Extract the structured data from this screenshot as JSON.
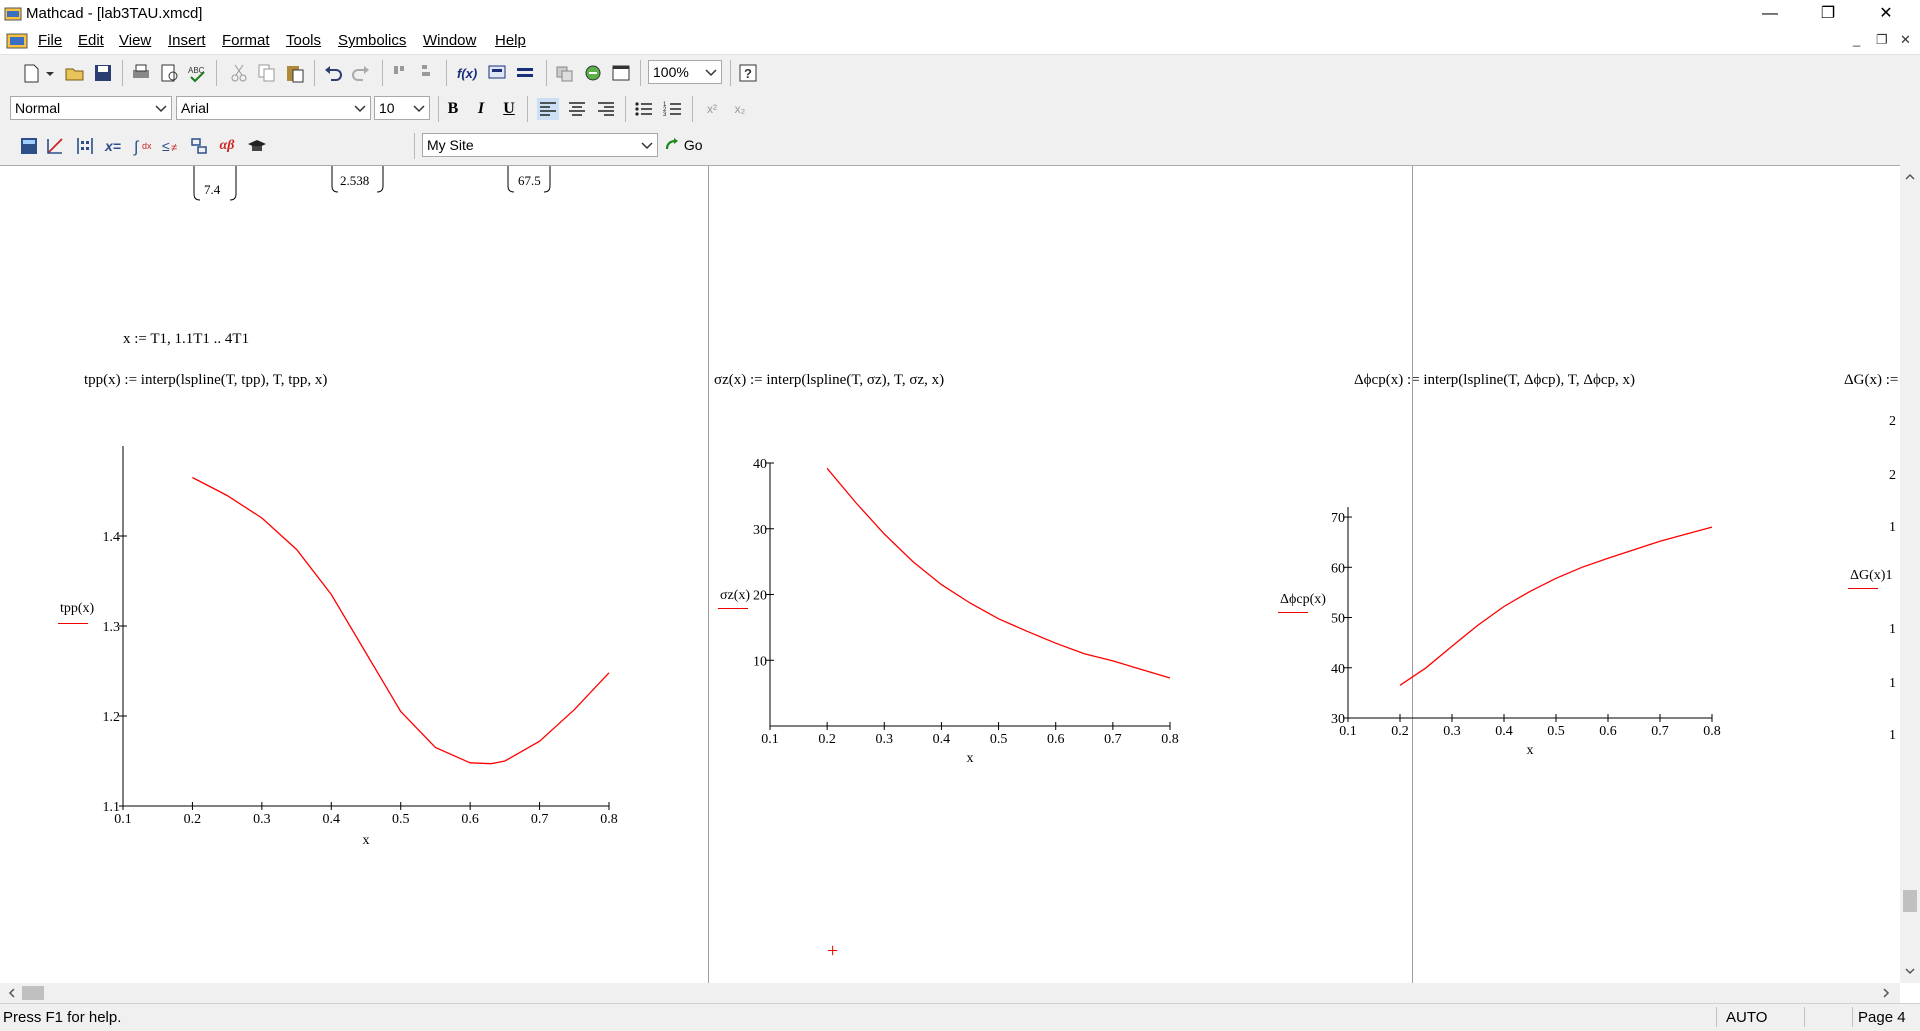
{
  "window": {
    "title": "Mathcad - [lab3TAU.xmcd]",
    "minimize": "—",
    "restore": "❐",
    "close": "✕"
  },
  "menu": {
    "items": [
      {
        "label": "File",
        "accel": "F"
      },
      {
        "label": "Edit",
        "accel": "E"
      },
      {
        "label": "View",
        "accel": "V"
      },
      {
        "label": "Insert",
        "accel": "I"
      },
      {
        "label": "Format",
        "accel": "o"
      },
      {
        "label": "Tools",
        "accel": "T"
      },
      {
        "label": "Symbolics",
        "accel": "S"
      },
      {
        "label": "Window",
        "accel": "W"
      },
      {
        "label": "Help",
        "accel": "H"
      }
    ],
    "mdi_min": "_",
    "mdi_restore": "❐",
    "mdi_close": "✕"
  },
  "toolbar": {
    "zoom": "100%"
  },
  "formatbar": {
    "style": "Normal",
    "font": "Arial",
    "size": "10",
    "bold": "B",
    "italic": "I",
    "underline": "U",
    "superscript": "x²",
    "subscript": "x₂"
  },
  "mathbar": {
    "site": "My Site",
    "go": "Go",
    "xeq": "x=",
    "greek": "αβ"
  },
  "doc": {
    "vec_top_1": "7.4",
    "vec_top_2": "2.538",
    "vec_top_3": "67.5",
    "range_def": "x := T1, 1.1T1 .. 4T1",
    "def_tpp": "tpp(x) := interp(lspline(T, tpp), T, tpp, x)",
    "def_sz": "σz(x) := interp(lspline(T, σz), T, σz, x)",
    "def_dfcp": "Δϕcp(x) := interp(lspline(T, Δϕcp), T, Δϕcp, x)",
    "def_dg": "ΔG(x) :=",
    "cross_marker": "+"
  },
  "chart_data": [
    {
      "type": "line",
      "ylabel": "tpp(x)",
      "xlabel": "x",
      "xlim": [
        0.1,
        0.8
      ],
      "ylim": [
        1.1,
        1.5
      ],
      "xticks": [
        "0.1",
        "0.2",
        "0.3",
        "0.4",
        "0.5",
        "0.6",
        "0.7",
        "0.8"
      ],
      "yticks": [
        "1.1",
        "1.2",
        "1.3",
        "1.4"
      ],
      "color": "#ff0000",
      "x": [
        0.2,
        0.25,
        0.3,
        0.35,
        0.4,
        0.45,
        0.5,
        0.55,
        0.6,
        0.63,
        0.65,
        0.7,
        0.75,
        0.8
      ],
      "y": [
        1.465,
        1.445,
        1.42,
        1.385,
        1.335,
        1.27,
        1.205,
        1.165,
        1.148,
        1.147,
        1.15,
        1.172,
        1.207,
        1.248
      ]
    },
    {
      "type": "line",
      "ylabel": "σz(x)",
      "xlabel": "x",
      "xlim": [
        0.1,
        0.8
      ],
      "ylim": [
        0,
        40
      ],
      "xticks": [
        "0.1",
        "0.2",
        "0.3",
        "0.4",
        "0.5",
        "0.6",
        "0.7",
        "0.8"
      ],
      "yticks": [
        "10",
        "20",
        "30",
        "40"
      ],
      "color": "#ff0000",
      "x": [
        0.2,
        0.25,
        0.3,
        0.35,
        0.4,
        0.45,
        0.5,
        0.55,
        0.6,
        0.65,
        0.7,
        0.75,
        0.8
      ],
      "y": [
        39.2,
        34.0,
        29.2,
        25.0,
        21.5,
        18.7,
        16.3,
        14.4,
        12.6,
        11.0,
        9.9,
        8.6,
        7.3
      ]
    },
    {
      "type": "line",
      "ylabel": "Δϕcp(x)",
      "xlabel": "x",
      "xlim": [
        0.1,
        0.8
      ],
      "ylim": [
        30,
        72
      ],
      "xticks": [
        "0.1",
        "0.2",
        "0.3",
        "0.4",
        "0.5",
        "0.6",
        "0.7",
        "0.8"
      ],
      "yticks": [
        "30",
        "40",
        "50",
        "60",
        "70"
      ],
      "color": "#ff0000",
      "x": [
        0.2,
        0.25,
        0.3,
        0.35,
        0.4,
        0.45,
        0.5,
        0.55,
        0.6,
        0.65,
        0.7,
        0.75,
        0.8
      ],
      "y": [
        36.5,
        40.0,
        44.3,
        48.5,
        52.2,
        55.2,
        57.8,
        60.0,
        61.8,
        63.5,
        65.2,
        66.6,
        68.0
      ]
    }
  ],
  "dg_partial": {
    "ylabel": "ΔG(x)1",
    "ticks": [
      "2",
      "2",
      "1",
      "1",
      "1",
      "1"
    ]
  },
  "status": {
    "help": "Press F1 for help.",
    "mode": "AUTO",
    "page": "Page 4"
  }
}
